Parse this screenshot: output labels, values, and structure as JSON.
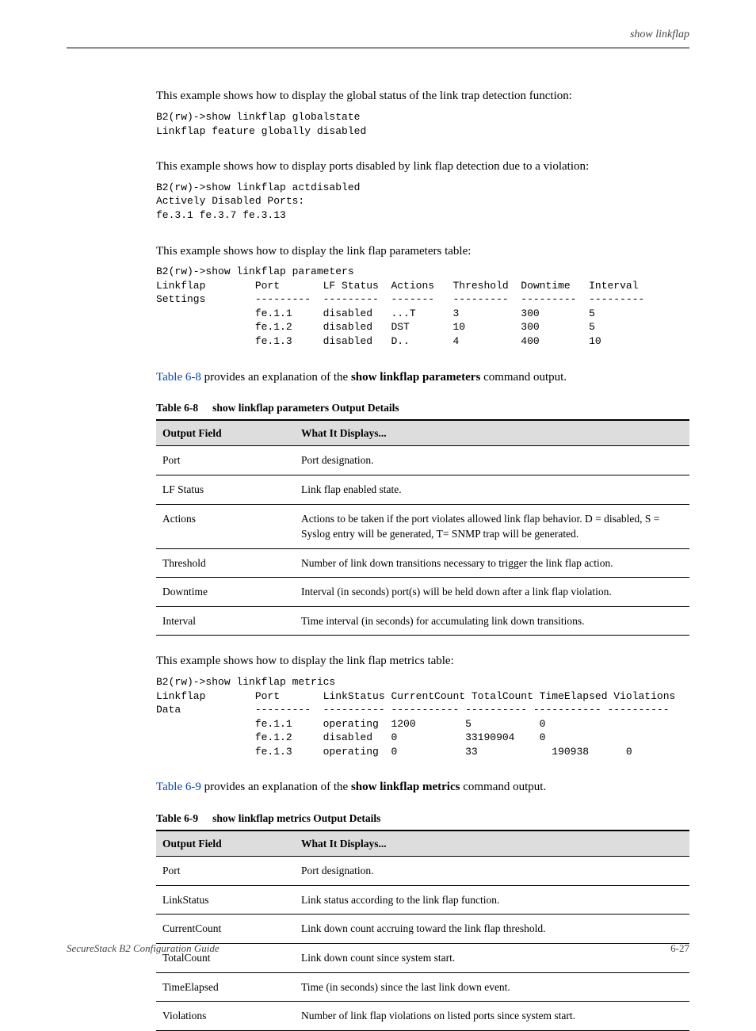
{
  "header": {
    "section": "show linkflap"
  },
  "body": {
    "p1": "This example shows how to display the global status of the link trap detection function:",
    "code1": "B2(rw)->show linkflap globalstate\nLinkflap feature globally disabled",
    "p2": "This example shows how to display ports disabled by link flap detection due to a violation:",
    "code2": "B2(rw)->show linkflap actdisabled\nActively Disabled Ports:\nfe.3.1 fe.3.7 fe.3.13",
    "p3": "This example shows how to display the link flap parameters table:",
    "code3": "B2(rw)->show linkflap parameters\nLinkflap        Port       LF Status  Actions   Threshold  Downtime   Interval\nSettings        ---------  ---------  -------   ---------  ---------  ---------\n                fe.1.1     disabled   ...T      3          300        5\n                fe.1.2     disabled   DST       10         300        5\n                fe.1.3     disabled   D..       4          400        10",
    "p4a": "Table 6-8",
    "p4b": " provides an explanation of the ",
    "p4c": "show linkflap parameters",
    "p4d": " command output.",
    "p5": "This example shows how to display the link flap metrics table:",
    "code5": "B2(rw)->show linkflap metrics\nLinkflap        Port       LinkStatus CurrentCount TotalCount TimeElapsed Violations\nData            ---------  ---------- ----------- ---------- ----------- ----------\n                fe.1.1     operating  1200        5           0\n                fe.1.2     disabled   0           33190904    0\n                fe.1.3     operating  0           33            190938      0",
    "p6a": "Table 6-9",
    "p6b": " provides an explanation of the ",
    "p6c": "show linkflap metrics",
    "p6d": " command output."
  },
  "table1": {
    "number": "Table 6-8",
    "title": "show linkflap parameters Output Details",
    "col1": "Output Field",
    "col2": "What It Displays...",
    "rows": [
      {
        "a": "Port",
        "b": "Port designation."
      },
      {
        "a": "LF Status",
        "b": "Link flap enabled state."
      },
      {
        "a": "Actions",
        "b": "Actions to be taken if the port violates allowed link flap behavior. D = disabled, S = Syslog entry will be generated, T= SNMP trap will be generated."
      },
      {
        "a": "Threshold",
        "b": "Number of link down transitions necessary to trigger the link flap action."
      },
      {
        "a": "Downtime",
        "b": "Interval (in seconds) port(s) will be held down after a link flap violation."
      },
      {
        "a": "Interval",
        "b": "Time interval (in seconds) for accumulating link down transitions."
      }
    ]
  },
  "table2": {
    "number": "Table 6-9",
    "title": "show linkflap metrics Output Details",
    "col1": "Output Field",
    "col2": "What It Displays...",
    "rows": [
      {
        "a": "Port",
        "b": "Port designation."
      },
      {
        "a": "LinkStatus",
        "b": "Link status according to the link flap function."
      },
      {
        "a": "CurrentCount",
        "b": "Link down count accruing toward the link flap threshold."
      },
      {
        "a": "TotalCount",
        "b": "Link down count since system start."
      },
      {
        "a": "TimeElapsed",
        "b": "Time (in seconds) since the last link down event."
      },
      {
        "a": "Violations",
        "b": "Number of link flap violations on listed ports since system start."
      }
    ]
  },
  "footer": {
    "title": "SecureStack B2 Configuration Guide",
    "page": "6-27"
  }
}
